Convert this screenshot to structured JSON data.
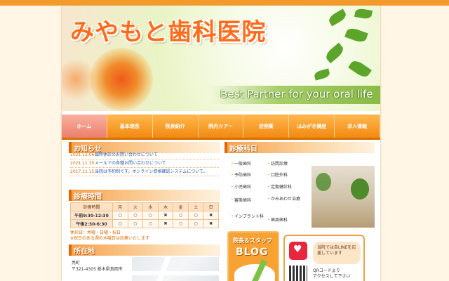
{
  "header": {
    "site_title": "みやもと歯科医院",
    "tagline": "Best Partner for your oral life"
  },
  "nav": {
    "items": [
      {
        "label": "ホーム"
      },
      {
        "label": "基本理念"
      },
      {
        "label": "院長紹介"
      },
      {
        "label": "院内ツアー"
      },
      {
        "label": "症例集"
      },
      {
        "label": "はみがき講座"
      },
      {
        "label": "求人情報"
      }
    ]
  },
  "news": {
    "heading": "お知らせ",
    "items": [
      {
        "date": "2021.12.06",
        "text": "臨時休診のお問い合わせについて"
      },
      {
        "date": "2021.11.30",
        "text": "メールでの各種お問い合わせについて"
      },
      {
        "date": "2017.11.15",
        "text": "当院は予約制です。オンライン資格確認システムについて。"
      }
    ]
  },
  "hours": {
    "heading": "診療時間",
    "columns": [
      "診療時間",
      "月",
      "火",
      "水",
      "木",
      "金",
      "土",
      "日"
    ],
    "rows": [
      {
        "label": "午前9:30-12:30",
        "cells": [
          "○",
          "○",
          "○",
          "✖",
          "○",
          "○",
          "✖"
        ]
      },
      {
        "label": "午後2:30-6:30",
        "cells": [
          "○",
          "○",
          "○",
          "✖",
          "○",
          "○",
          "✖"
        ]
      }
    ],
    "note1": "休診日：木曜・日曜・祝日",
    "note2": "※祝日のある週の木曜日は診療いたします"
  },
  "access": {
    "heading": "所在地",
    "line1": "亮町",
    "line2": "〒321-4305 栃木県真岡市"
  },
  "departments": {
    "heading": "診療科目",
    "items": [
      "一般歯科",
      "訪問診療",
      "予防歯科",
      "口腔外科",
      "小児歯科",
      "定期健診科",
      "審美歯科",
      "かみあわせ治療",
      "インプラント科",
      "歯周歯科"
    ]
  },
  "blog": {
    "label_top": "院長＆スタッフ",
    "label_main": "BLOG"
  },
  "qr": {
    "bubble": "当院では自LINEを応援しています",
    "text_line1": "QRコードより",
    "text_line2": "アクセスして下さい"
  },
  "colors": {
    "accent": "#f39b2a",
    "title": "#ff6b1a",
    "nav_active": "#ec7f6b",
    "link": "#2a5ba8"
  }
}
